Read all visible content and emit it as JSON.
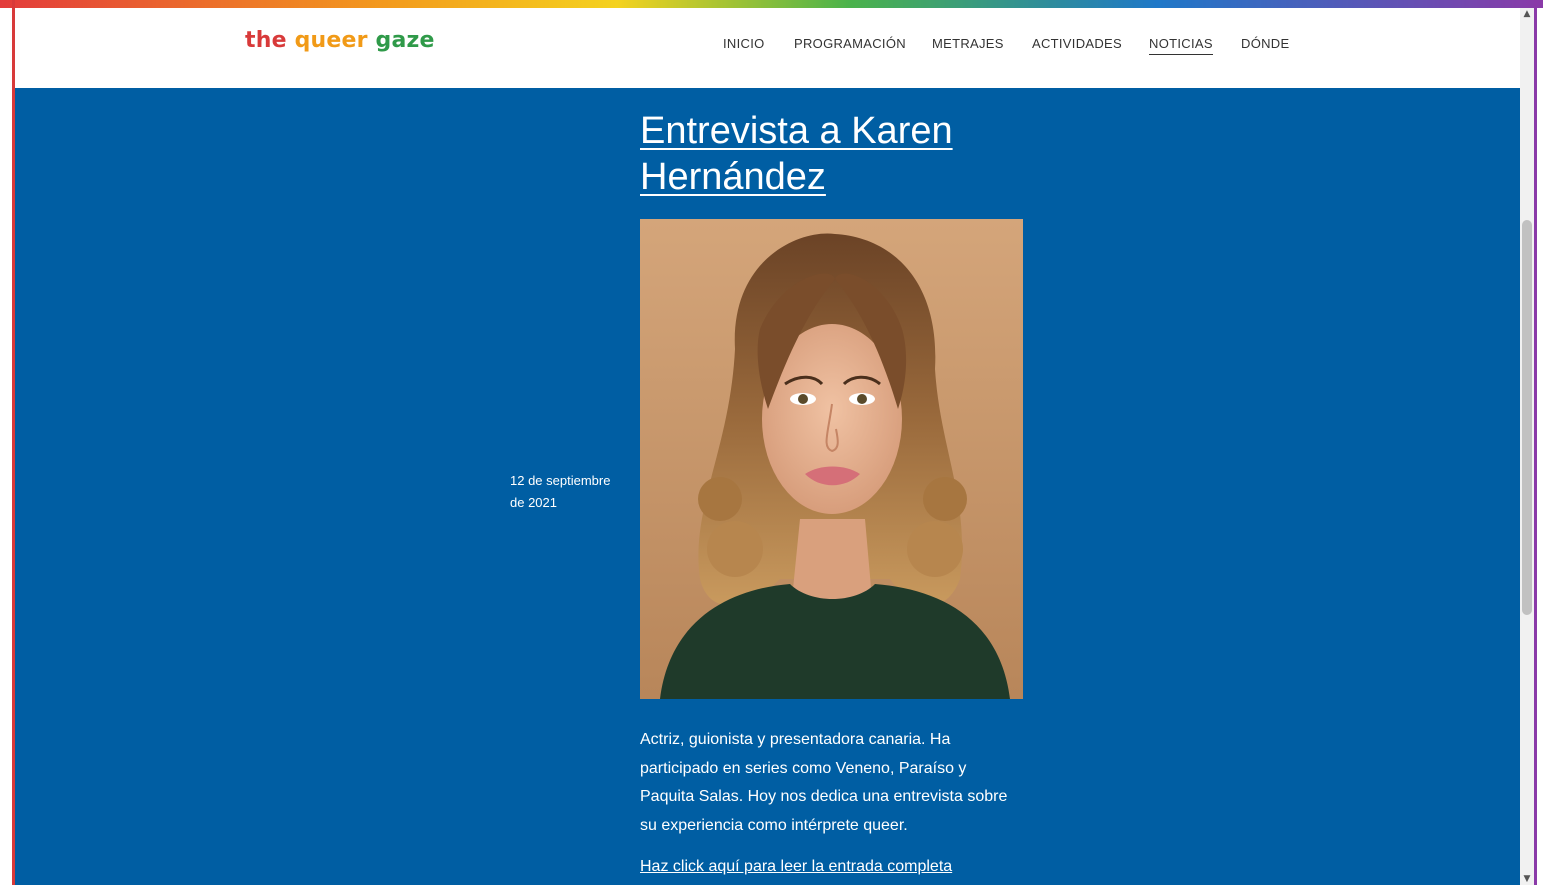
{
  "header": {
    "logo": {
      "part1": "the",
      "part2": "queer",
      "part3": "gaze"
    },
    "nav": [
      {
        "label": "INICIO",
        "active": false
      },
      {
        "label": "PROGRAMACIÓN",
        "active": false
      },
      {
        "label": "METRAJES",
        "active": false
      },
      {
        "label": "ACTIVIDADES",
        "active": false
      },
      {
        "label": "NOTICIAS",
        "active": true
      },
      {
        "label": "DÓNDE",
        "active": false
      }
    ]
  },
  "post": {
    "title": "Entrevista a Karen Hernández",
    "date": "12 de septiembre de 2021",
    "excerpt": "Actriz, guionista y presentadora canaria. Ha participado en series como Veneno, Paraíso y Paquita Salas. Hoy nos dedica una entrevista sobre su experiencia como intérprete queer.",
    "read_more": "Haz click aquí para leer la entrada completa"
  },
  "colors": {
    "main_background": "#005ea3",
    "header_background": "#ffffff",
    "text_light": "#ffffff"
  },
  "icons": {
    "scroll_up": "chevron-up-icon",
    "scroll_down": "chevron-down-icon"
  }
}
